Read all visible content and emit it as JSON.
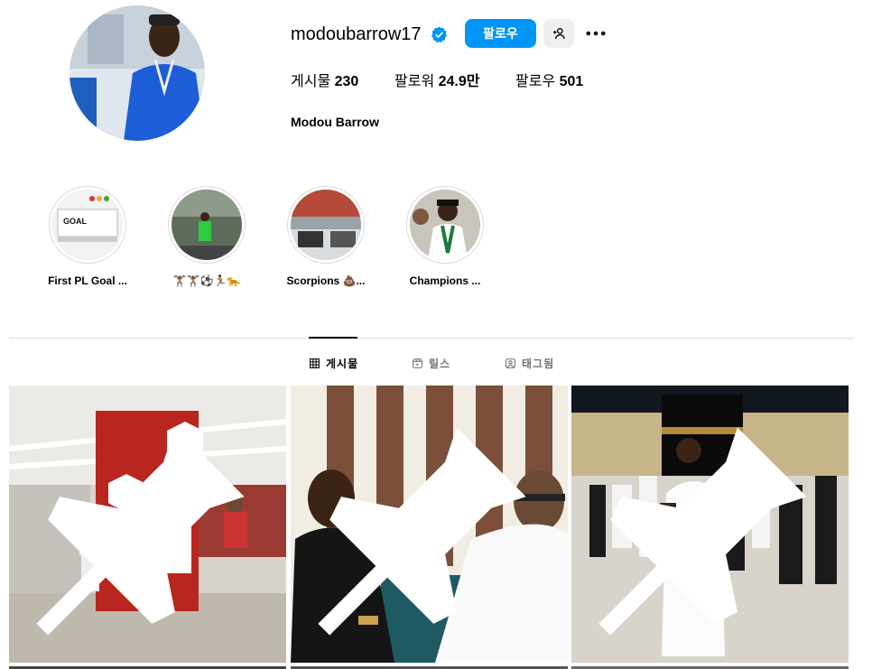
{
  "profile": {
    "username": "modoubarrow17",
    "verified": true,
    "full_name": "Modou Barrow",
    "follow_label": "팔로우",
    "suggest_icon": "person-add-icon",
    "more_icon": "more-icon"
  },
  "stats": {
    "posts_label": "게시물",
    "posts_value": "230",
    "followers_label": "팔로워",
    "followers_value": "24.9만",
    "following_label": "팔로우",
    "following_value": "501"
  },
  "highlights": [
    {
      "label": "First PL Goal ..."
    },
    {
      "label": "🏋🏿🏋🏿⚽🏃🏿🐆"
    },
    {
      "label": "Scorpions 💩..."
    },
    {
      "label": "Champions ..."
    }
  ],
  "tabs": [
    {
      "label": "게시물",
      "icon": "grid-icon",
      "active": true
    },
    {
      "label": "릴스",
      "icon": "reels-icon",
      "active": false
    },
    {
      "label": "태그됨",
      "icon": "tagged-icon",
      "active": false
    }
  ],
  "colors": {
    "accent": "#0095f6",
    "verified": "#0095f6",
    "divider": "#dbdbdb"
  },
  "posts": [
    {
      "pinned": true,
      "pin_icon": "pin-icon"
    },
    {
      "pinned": true,
      "pin_icon": "pin-icon"
    },
    {
      "pinned": true,
      "pin_icon": "pin-icon"
    }
  ]
}
